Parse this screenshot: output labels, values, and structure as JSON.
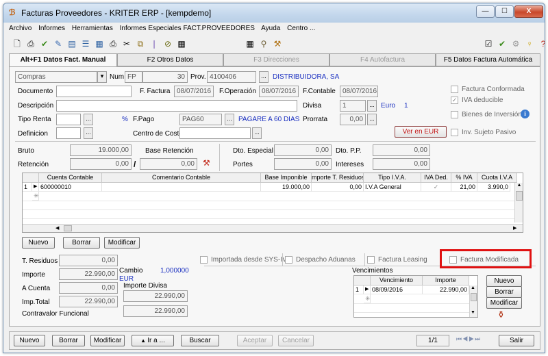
{
  "window": {
    "title": "Facturas Proveedores  -  KRITER ERP - [kempdemo]",
    "minimize": "—",
    "maximize": "☐",
    "close": "X"
  },
  "menu": [
    "Archivo",
    "Informes",
    "Herramientas",
    "Informes Especiales FACT.PROVEEDORES",
    "Ayuda",
    "Centro ..."
  ],
  "tabs": {
    "tab1": "Alt+F1 Datos Fact. Manual",
    "tab2": "F2 Otros Datos",
    "tab3": "F3 Direcciones",
    "tab4": "F4 Autofactura",
    "tab5": "F5 Datos Factura Automática"
  },
  "header": {
    "tipo": "Compras",
    "num_label": "Num.",
    "num_series": "FP",
    "num_value": "30",
    "prov_label": "Prov.",
    "prov_code": "4100406",
    "prov_name": "DISTRIBUIDORA, SA",
    "documento_label": "Documento",
    "documento_value": "",
    "f_factura_label": "F. Factura",
    "f_factura_value": "08/07/2016",
    "f_operacion_label": "F.Operación",
    "f_operacion_value": "08/07/2016",
    "f_contable_label": "F.Contable",
    "f_contable_value": "08/07/2016",
    "descripcion_label": "Descripción",
    "descripcion_value": "",
    "divisa_label": "Divisa",
    "divisa_code": "1",
    "divisa_name": "Euro",
    "divisa_num": "1",
    "tipo_renta_label": "Tipo Renta",
    "tipo_renta_value": "",
    "percent": "%",
    "fpago_label": "F.Pago",
    "fpago_code": "PAG60",
    "fpago_name": "PAGARE A 60 DIAS",
    "prorrata_label": "Prorrata",
    "prorrata_value": "0,00",
    "definicion_label": "Definicion",
    "definicion_value": "",
    "centro_coste_label": "Centro de Coste",
    "centro_coste_value": "",
    "ver_en_eur": "Ver en EUR",
    "more": "..."
  },
  "checks": {
    "factura_conformada": "Factura Conformada",
    "iva_deducible": "IVA deducible",
    "bienes_inversion": "Bienes de Inversión",
    "inv_sujeto_pasivo": "Inv. Sujeto Pasivo",
    "info_icon": "i"
  },
  "totals": {
    "bruto_label": "Bruto",
    "bruto_value": "19.000,00",
    "base_retencion_label": "Base Retención",
    "base_retencion_value": "",
    "retencion_label": "Retención",
    "retencion_pct": "0,00",
    "retencion_slash": "/",
    "retencion_value": "0,00",
    "dto_especial_label": "Dto. Especial",
    "dto_especial_value": "0,00",
    "dto_pp_label": "Dto. P.P.",
    "dto_pp_value": "0,00",
    "portes_label": "Portes",
    "portes_value": "0,00",
    "intereses_label": "Intereses",
    "intereses_value": "0,00"
  },
  "lines_grid": {
    "columns": [
      "Cuenta Contable",
      "Comentario Contable",
      "Base Imponible",
      "mporte T. Residuos",
      "Tipo I.V.A.",
      "IVA Ded.",
      "% IVA",
      "Cuota I.V.A"
    ],
    "rows": [
      {
        "num": "1",
        "cuenta": "600000010",
        "comentario": "",
        "base": "19.000,00",
        "residuos": "0,00",
        "tipo_iva": "I.V.A General",
        "iva_ded": "✓",
        "pct_iva": "21,00",
        "cuota": "3.990,0"
      }
    ],
    "new_row_marker": "✳"
  },
  "grid_buttons": {
    "nuevo": "Nuevo",
    "borrar": "Borrar",
    "modificar": "Modificar"
  },
  "bottom": {
    "t_residuos_label": "T. Residuos",
    "t_residuos_value": "0,00",
    "importe_label": "Importe",
    "importe_value": "22.990,00",
    "cambio_label": "Cambio",
    "cambio_value": "1,000000",
    "cambio_currency": "EUR",
    "a_cuenta_label": "A Cuenta",
    "a_cuenta_value": "0,00",
    "importe_divisa_label": "Importe Divisa",
    "importe_divisa_value": "22.990,00",
    "imp_total_label": "Imp.Total",
    "imp_total_value": "22.990,00",
    "contravalor_label": "Contravalor Funcional",
    "contravalor_value": "22.990,00",
    "importada_sys": "Importada desde SYS-IV",
    "despacho_aduanas": "Despacho Aduanas",
    "factura_leasing": "Factura Leasing",
    "factura_modificada": "Factura Modificada"
  },
  "vencimientos": {
    "title": "Vencimientos",
    "columns": [
      "Vencimiento",
      "Importe"
    ],
    "rows": [
      {
        "num": "1",
        "vencimiento": "08/09/2016",
        "importe": "22.990,00"
      }
    ],
    "nuevo": "Nuevo",
    "borrar": "Borrar",
    "modificar": "Modificar"
  },
  "footer": {
    "nuevo": "Nuevo",
    "borrar": "Borrar",
    "modificar": "Modificar",
    "ir_a": "Ir a ...",
    "buscar": "Buscar",
    "aceptar": "Aceptar",
    "cancelar": "Cancelar",
    "page": "1/1",
    "salir": "Salir"
  }
}
